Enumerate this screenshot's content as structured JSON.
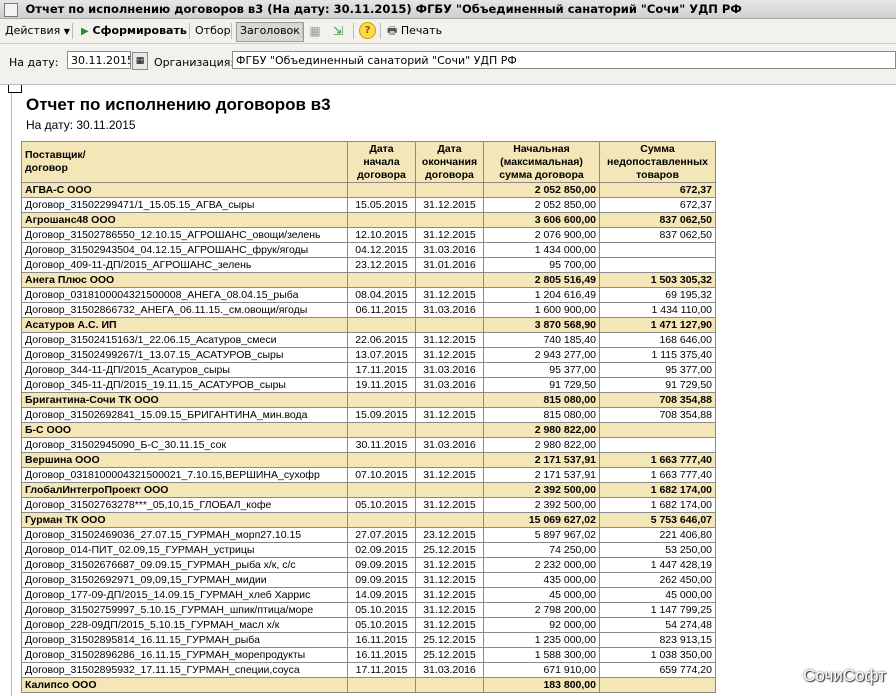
{
  "window": {
    "title": "Отчет по исполнению договоров в3 (На дату: 30.11.2015) ФГБУ \"Объединенный санаторий \"Сочи\" УДП РФ"
  },
  "toolbar": {
    "actions_label": "Действия",
    "generate_label": "Сформировать",
    "selection_label": "Отбор",
    "header_label": "Заголовок",
    "print_label": "Печать"
  },
  "filters": {
    "date_label": "На дату:",
    "date_value": "30.11.2015",
    "org_label": "Организация:",
    "org_value": "ФГБУ \"Объединенный санаторий \"Сочи\" УДП РФ"
  },
  "report": {
    "title": "Отчет по исполнению договоров в3",
    "date_line": "На дату: 30.11.2015",
    "columns": {
      "supplier": "Поставщик/\nдоговор",
      "start": "Дата\nначала\nдоговора",
      "end": "Дата\nокончания\nдоговора",
      "initial": "Начальная\n(максимальная)\nсумма договора",
      "undelivered": "Сумма\nнедопоставленных\nтоваров"
    },
    "rows": [
      {
        "g": true,
        "name": "АГВА-С ООО",
        "start": "",
        "end": "",
        "initial": "2 052 850,00",
        "und": "672,37"
      },
      {
        "g": false,
        "name": "Договор_31502299471/1_15.05.15_АГВА_сыры",
        "start": "15.05.2015",
        "end": "31.12.2015",
        "initial": "2 052 850,00",
        "und": "672,37"
      },
      {
        "g": true,
        "name": "Агрошанс48 ООО",
        "start": "",
        "end": "",
        "initial": "3 606 600,00",
        "und": "837 062,50"
      },
      {
        "g": false,
        "name": "Договор_31502786550_12.10.15_АГРОШАНС_овощи/зелень",
        "start": "12.10.2015",
        "end": "31.12.2015",
        "initial": "2 076 900,00",
        "und": "837 062,50"
      },
      {
        "g": false,
        "name": "Договор_31502943504_04.12.15_АГРОШАНС_фрук/ягоды",
        "start": "04.12.2015",
        "end": "31.03.2016",
        "initial": "1 434 000,00",
        "und": ""
      },
      {
        "g": false,
        "name": "Договор_409-11-ДП/2015_АГРОШАНС_зелень",
        "start": "23.12.2015",
        "end": "31.01.2016",
        "initial": "95 700,00",
        "und": ""
      },
      {
        "g": true,
        "name": "Анега Плюс ООО",
        "start": "",
        "end": "",
        "initial": "2 805 516,49",
        "und": "1 503 305,32"
      },
      {
        "g": false,
        "name": "Договор_0318100004321500008_АНЕГА_08.04.15_рыба",
        "start": "08.04.2015",
        "end": "31.12.2015",
        "initial": "1 204 616,49",
        "und": "69 195,32"
      },
      {
        "g": false,
        "name": "Договор_31502866732_АНЕГА_06.11.15._см.овощи/ягоды",
        "start": "06.11.2015",
        "end": "31.03.2016",
        "initial": "1 600 900,00",
        "und": "1 434 110,00"
      },
      {
        "g": true,
        "name": "Асатуров А.С. ИП",
        "start": "",
        "end": "",
        "initial": "3 870 568,90",
        "und": "1 471 127,90"
      },
      {
        "g": false,
        "name": "Договор_31502415163/1_22.06.15_Асатуров_смеси",
        "start": "22.06.2015",
        "end": "31.12.2015",
        "initial": "740 185,40",
        "und": "168 646,00"
      },
      {
        "g": false,
        "name": "Договор_31502499267/1_13.07.15_АСАТУРОВ_сыры",
        "start": "13.07.2015",
        "end": "31.12.2015",
        "initial": "2 943 277,00",
        "und": "1 115 375,40"
      },
      {
        "g": false,
        "name": "Договор_344-11-ДП/2015_Асатуров_сыры",
        "start": "17.11.2015",
        "end": "31.03.2016",
        "initial": "95 377,00",
        "und": "95 377,00"
      },
      {
        "g": false,
        "name": "Договор_345-11-ДП/2015_19.11.15_АСАТУРОВ_сыры",
        "start": "19.11.2015",
        "end": "31.03.2016",
        "initial": "91 729,50",
        "und": "91 729,50"
      },
      {
        "g": true,
        "name": "Бригантина-Сочи ТК ООО",
        "start": "",
        "end": "",
        "initial": "815 080,00",
        "und": "708 354,88"
      },
      {
        "g": false,
        "name": "Договор_31502692841_15.09.15_БРИГАНТИНА_мин.вода",
        "start": "15.09.2015",
        "end": "31.12.2015",
        "initial": "815 080,00",
        "und": "708 354,88"
      },
      {
        "g": true,
        "name": "Б-С ООО",
        "start": "",
        "end": "",
        "initial": "2 980 822,00",
        "und": ""
      },
      {
        "g": false,
        "name": "Договор_31502945090_Б-С_30.11.15_сок",
        "start": "30.11.2015",
        "end": "31.03.2016",
        "initial": "2 980 822,00",
        "und": ""
      },
      {
        "g": true,
        "name": "Вершина ООО",
        "start": "",
        "end": "",
        "initial": "2 171 537,91",
        "und": "1 663 777,40"
      },
      {
        "g": false,
        "name": "Договор_0318100004321500021_7.10.15,ВЕРШИНА_сухофр",
        "start": "07.10.2015",
        "end": "31.12.2015",
        "initial": "2 171 537,91",
        "und": "1 663 777,40"
      },
      {
        "g": true,
        "name": "ГлобалИнтегроПроект ООО",
        "start": "",
        "end": "",
        "initial": "2 392 500,00",
        "und": "1 682 174,00"
      },
      {
        "g": false,
        "name": "Договор_31502763278***_05,10,15_ГЛОБАЛ_кофе",
        "start": "05.10.2015",
        "end": "31.12.2015",
        "initial": "2 392 500,00",
        "und": "1 682 174,00"
      },
      {
        "g": true,
        "name": "Гурман ТК ООО",
        "start": "",
        "end": "",
        "initial": "15 069 627,02",
        "und": "5 753 646,07"
      },
      {
        "g": false,
        "name": "Договор_31502469036_27.07.15_ГУРМАН_морп27.10.15",
        "start": "27.07.2015",
        "end": "23.12.2015",
        "initial": "5 897 967,02",
        "und": "221 406,80"
      },
      {
        "g": false,
        "name": "Договор_014-ПИТ_02.09,15_ГУРМАН_устрицы",
        "start": "02.09.2015",
        "end": "25.12.2015",
        "initial": "74 250,00",
        "und": "53 250,00"
      },
      {
        "g": false,
        "name": "Договор_31502676687_09.09.15_ГУРМАН_рыба х/к, с/с",
        "start": "09.09.2015",
        "end": "31.12.2015",
        "initial": "2 232 000,00",
        "und": "1 447 428,19"
      },
      {
        "g": false,
        "name": "Договор_31502692971_09,09,15_ГУРМАН_мидии",
        "start": "09.09.2015",
        "end": "31.12.2015",
        "initial": "435 000,00",
        "und": "262 450,00"
      },
      {
        "g": false,
        "name": "Договор_177-09-ДП/2015_14.09.15_ГУРМАН_хлеб Харрис",
        "start": "14.09.2015",
        "end": "31.12.2015",
        "initial": "45 000,00",
        "und": "45 000,00"
      },
      {
        "g": false,
        "name": "Договор_31502759997_5.10.15_ГУРМАН_шпик/птица/море",
        "start": "05.10.2015",
        "end": "31.12.2015",
        "initial": "2 798 200,00",
        "und": "1 147 799,25"
      },
      {
        "g": false,
        "name": "Договор_228-09ДП/2015_5.10.15_ГУРМАН_масл х/к",
        "start": "05.10.2015",
        "end": "31.12.2015",
        "initial": "92 000,00",
        "und": "54 274,48"
      },
      {
        "g": false,
        "name": "Договор_31502895814_16.11.15_ГУРМАН_рыба",
        "start": "16.11.2015",
        "end": "25.12.2015",
        "initial": "1 235 000,00",
        "und": "823 913,15"
      },
      {
        "g": false,
        "name": "Договор_31502896286_16.11.15_ГУРМАН_морепродукты",
        "start": "16.11.2015",
        "end": "25.12.2015",
        "initial": "1 588 300,00",
        "und": "1 038 350,00"
      },
      {
        "g": false,
        "name": "Договор_31502895932_17.11.15_ГУРМАН_специи,соуса",
        "start": "17.11.2015",
        "end": "31.03.2016",
        "initial": "671 910,00",
        "und": "659 774,20"
      },
      {
        "g": true,
        "name": "Калипсо ООО",
        "start": "",
        "end": "",
        "initial": "183 800,00",
        "und": ""
      }
    ]
  },
  "watermark": "СочиСофт"
}
